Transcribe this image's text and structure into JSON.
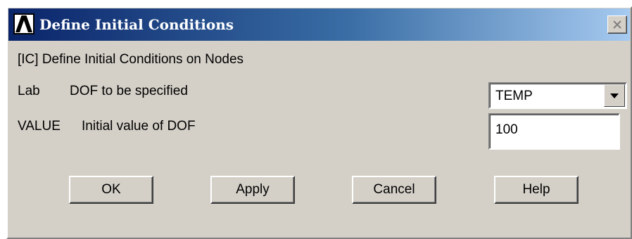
{
  "window": {
    "title": "Define Initial Conditions",
    "app_icon": "ansys-logo-icon",
    "close_icon": "close-icon"
  },
  "form": {
    "heading": "[IC]  Define Initial Conditions on Nodes",
    "lab_key": "Lab",
    "lab_desc": "DOF to be specified",
    "lab_value": "TEMP",
    "value_key": "VALUE",
    "value_desc": "Initial value of DOF",
    "value_value": "100"
  },
  "buttons": {
    "ok": "OK",
    "apply": "Apply",
    "cancel": "Cancel",
    "help": "Help"
  },
  "colors": {
    "titlebar_start": "#0a246a",
    "titlebar_end": "#a6caf0",
    "dialog_face": "#d4d0c8"
  }
}
